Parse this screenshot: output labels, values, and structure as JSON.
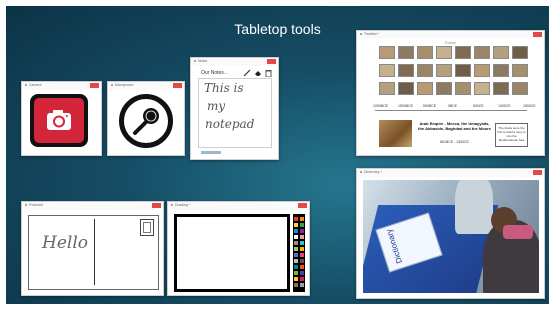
{
  "slide": {
    "title": "Tabletop tools"
  },
  "windows": {
    "camera": {
      "title": "Camera"
    },
    "microphone": {
      "title": "Microphone"
    },
    "notes": {
      "title": "Notes",
      "heading": "Our Notes...",
      "handwriting": [
        "This is",
        "my",
        "notepad"
      ]
    },
    "timeline": {
      "title": "Timeline *",
      "header": "Events",
      "dates": [
        "1000BCE",
        "1500BCE",
        "500BCE",
        "0BCE",
        "500CE",
        "1000CE",
        "1500CE"
      ],
      "event_title": "Arab Empire - Mecca, the Umayyads, the Abbasids, Baghdad and the Moors",
      "event_date": "661BCE - 1300CE",
      "side_note": "The Arabs were the first to build a navy to rule the Mediterranean Sea"
    },
    "postcard": {
      "title": "Postcard",
      "handwriting": "Hello"
    },
    "drawing": {
      "title": "Drawing *"
    },
    "dictionary": {
      "title": "Dictionary *",
      "book_label": "Dictionary"
    }
  },
  "colors": {
    "background_dark": "#0c3346",
    "background_light": "#25768f",
    "camera_red": "#d3263a",
    "close_red": "#e24a4a"
  },
  "icons": [
    "camera-icon",
    "microphone-icon",
    "pencil-icon",
    "eraser-icon",
    "trash-icon"
  ]
}
